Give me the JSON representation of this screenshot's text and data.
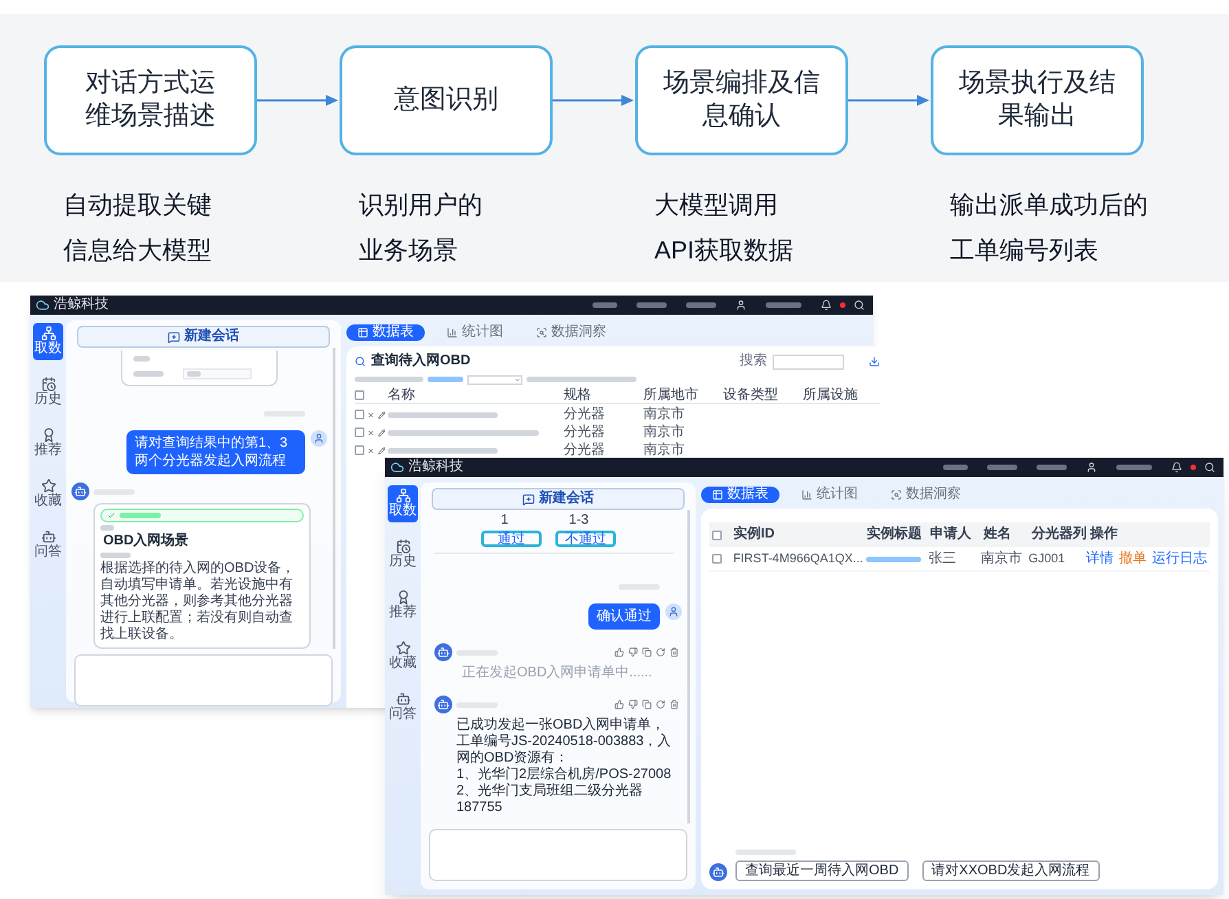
{
  "flow_steps": [
    {
      "title_lines": [
        "对话方式运",
        "维场景描述"
      ],
      "description_lines": [
        "自动提取关键",
        "信息给大模型"
      ]
    },
    {
      "title_lines": [
        "意图识别"
      ],
      "description_lines": [
        "识别用户的",
        "业务场景"
      ]
    },
    {
      "title_lines": [
        "场景编排及信",
        "息确认"
      ],
      "description_lines": [
        "大模型调用",
        "API获取数据"
      ]
    },
    {
      "title_lines": [
        "场景执行及结",
        "果输出"
      ],
      "description_lines": [
        "输出派单成功后的",
        "工单编号列表"
      ]
    }
  ],
  "query_screen": {
    "logo": "浩鲸科技",
    "nav": [
      {
        "label": "取数",
        "selected": true
      },
      {
        "label": "历史",
        "selected": false
      },
      {
        "label": "推荐",
        "selected": false
      },
      {
        "label": "收藏",
        "selected": false
      },
      {
        "label": "问答",
        "selected": false
      }
    ],
    "new_chat": "新建会话",
    "messages": [
      {
        "kind": "form"
      },
      {
        "kind": "user",
        "text": "请对查询结果中的第1、3两个分光器发起入网流程"
      },
      {
        "kind": "scene",
        "scene": "OBD入网场景",
        "body": "根据选择的待入网的OBD设备，自动填写申请单。若光设施中有其他分光器，则参考其他分光器进行上联配置；若没有则自动查找上联设备。"
      }
    ],
    "tabs": [
      {
        "label": "数据表",
        "selected": true
      },
      {
        "label": "统计图",
        "selected": false
      },
      {
        "label": "数据洞察",
        "selected": false
      }
    ],
    "table_title": "查询待入网OBD",
    "select_all_checked": false,
    "search_label": "搜索",
    "columns": [
      "名称",
      "规格",
      "所属地市",
      "设备类型",
      "所属设施"
    ],
    "rows": [
      {
        "checked": false,
        "spec": "分光器",
        "city": "南京市"
      },
      {
        "checked": false,
        "spec": "分光器",
        "city": "南京市"
      },
      {
        "checked": false,
        "spec": "分光器",
        "city": "南京市"
      }
    ]
  },
  "result_screen": {
    "logo": "浩鲸科技",
    "nav": [
      {
        "label": "取数",
        "selected": true
      },
      {
        "label": "历史",
        "selected": false
      },
      {
        "label": "推荐",
        "selected": false
      },
      {
        "label": "收藏",
        "selected": false
      },
      {
        "label": "问答",
        "selected": false
      }
    ],
    "new_chat": "新建会话",
    "messages": [
      {
        "kind": "approval",
        "labels": [
          "1",
          "1-3"
        ],
        "buttons": [
          "通过",
          "不通过"
        ]
      },
      {
        "kind": "user",
        "text": "确认通过"
      },
      {
        "kind": "bot_status",
        "text": "正在发起OBD入网申请单中......"
      },
      {
        "kind": "bot_result",
        "lines": [
          "已成功发起一张OBD入网申请单，工单编号JS-20240518-003883，入网的OBD资源有：",
          "1、光华门2层综合机房/POS-27008",
          "2、光华门支局班组二级分光器187755"
        ]
      }
    ],
    "tabs": [
      {
        "label": "数据表",
        "selected": true
      },
      {
        "label": "统计图",
        "selected": false
      },
      {
        "label": "数据洞察",
        "selected": false
      }
    ],
    "columns": [
      "实例ID",
      "实例标题",
      "申请人",
      "姓名",
      "分光器列",
      "操作"
    ],
    "select_all_checked": false,
    "rows": [
      {
        "checked": false,
        "id": "FIRST-4M966QA1QX...",
        "applicant": "张三",
        "name": "南京市",
        "splitter": "GJ001",
        "actions": [
          {
            "label": "详情",
            "color": "#1f6bff"
          },
          {
            "label": "撤单",
            "color": "#e8771c"
          },
          {
            "label": "运行日志",
            "color": "#1f6bff"
          }
        ]
      }
    ],
    "suggestions": [
      "查询最近一周待入网OBD",
      "请对XXOBD发起入网流程"
    ]
  }
}
